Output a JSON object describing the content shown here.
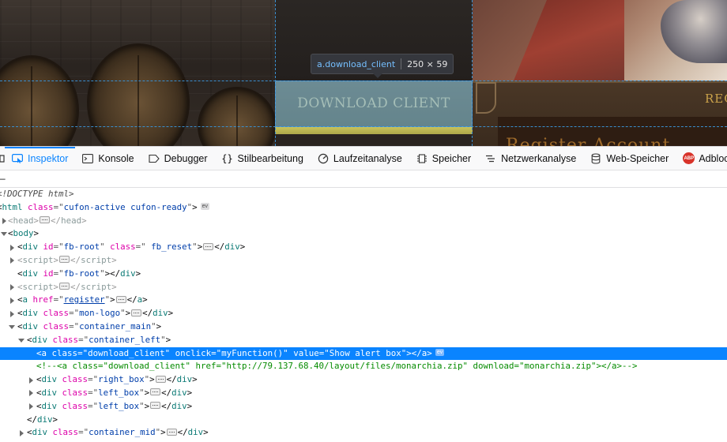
{
  "page": {
    "download_button_label": "DOWNLOAD CLIENT",
    "right_heading": "REG",
    "panel_title": "Register Account"
  },
  "highlighter": {
    "selector": "a.download_client",
    "dimensions": "250 × 59"
  },
  "toolbar": {
    "tabs": [
      {
        "label": "Inspektor",
        "icon": "inspector-icon",
        "active": true
      },
      {
        "label": "Konsole",
        "icon": "console-icon"
      },
      {
        "label": "Debugger",
        "icon": "debugger-icon"
      },
      {
        "label": "Stilbearbeitung",
        "icon": "braces-icon"
      },
      {
        "label": "Laufzeitanalyse",
        "icon": "performance-icon"
      },
      {
        "label": "Speicher",
        "icon": "memory-icon"
      },
      {
        "label": "Netzwerkanalyse",
        "icon": "network-icon"
      },
      {
        "label": "Web-Speicher",
        "icon": "storage-icon"
      },
      {
        "label": "Adbloc",
        "icon": "abp-icon",
        "badge": "ABP"
      }
    ]
  },
  "search": {
    "text": "–"
  },
  "markup": {
    "doctype": "<!DOCTYPE html>",
    "html": {
      "tag": "html",
      "attr": "class",
      "value": "cufon-active cufon-ready",
      "badge": "ev"
    },
    "head": {
      "tag": "head"
    },
    "body": {
      "tag": "body"
    },
    "fb_root_1": {
      "tag": "div",
      "a1": "id",
      "v1": "fb-root",
      "a2": "class",
      "v2": " fb_reset"
    },
    "script_1": {
      "tag": "script"
    },
    "fb_root_2": {
      "tag": "div",
      "attr": "id",
      "value": "fb-root"
    },
    "script_2": {
      "tag": "script"
    },
    "register_link": {
      "tag": "a",
      "attr": "href",
      "value": "register"
    },
    "mon_logo": {
      "tag": "div",
      "attr": "class",
      "value": "mon-logo"
    },
    "container_main": {
      "tag": "div",
      "attr": "class",
      "value": "container_main"
    },
    "container_left": {
      "tag": "div",
      "attr": "class",
      "value": "container_left"
    },
    "selected": {
      "tag": "a",
      "a1": "class",
      "v1": "download_client",
      "a2": "onclick",
      "v2": "myFunction()",
      "a3": "value",
      "v3": "Show alert box",
      "badge": "ev"
    },
    "comment": "<!--<a class=\"download_client\" href=\"http://79.137.68.40/layout/files/monarchia.zip\" download=\"monarchia.zip\"></a>-->",
    "right_box": {
      "tag": "div",
      "attr": "class",
      "value": "right_box"
    },
    "left_box_1": {
      "tag": "div",
      "attr": "class",
      "value": "left_box"
    },
    "left_box_2": {
      "tag": "div",
      "attr": "class",
      "value": "left_box"
    },
    "close_div": {
      "tag": "div"
    },
    "container_mid": {
      "tag": "div",
      "attr": "class",
      "value": "container_mid"
    }
  },
  "colors": {
    "accent": "#0a84ff",
    "highlight": "#70a8d8",
    "tag_name": "#0b7a75",
    "attr_name": "#dd00a9",
    "attr_value": "#003eaa",
    "comment": "#058b00"
  }
}
